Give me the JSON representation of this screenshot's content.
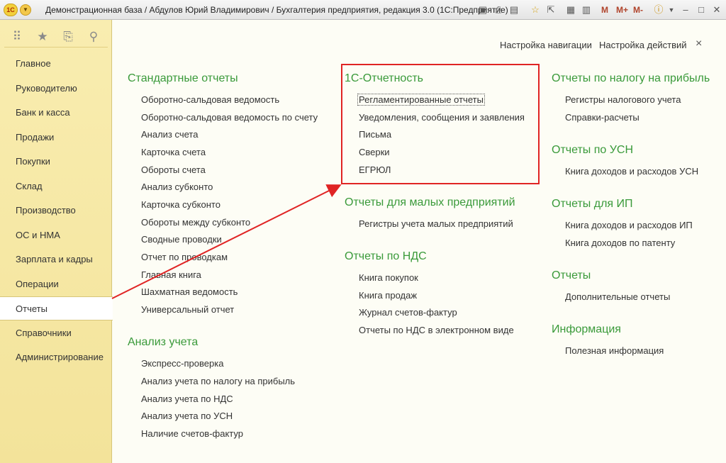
{
  "window": {
    "title": "Демонстрационная база / Абдулов Юрий Владимирович / Бухгалтерия предприятия, редакция 3.0  (1С:Предприятие)",
    "logo_text": "1С",
    "m_buttons": [
      "M",
      "M+",
      "M-"
    ]
  },
  "sidebar": {
    "items": [
      {
        "label": "Главное"
      },
      {
        "label": "Руководителю"
      },
      {
        "label": "Банк и касса"
      },
      {
        "label": "Продажи"
      },
      {
        "label": "Покупки"
      },
      {
        "label": "Склад"
      },
      {
        "label": "Производство"
      },
      {
        "label": "ОС и НМА"
      },
      {
        "label": "Зарплата и кадры"
      },
      {
        "label": "Операции"
      },
      {
        "label": "Отчеты"
      },
      {
        "label": "Справочники"
      },
      {
        "label": "Администрирование"
      }
    ],
    "active_index": 10
  },
  "header": {
    "nav_settings": "Настройка навигации",
    "action_settings": "Настройка действий",
    "close": "×"
  },
  "columns": {
    "col1": [
      {
        "title": "Стандартные отчеты",
        "items": [
          "Оборотно-сальдовая ведомость",
          "Оборотно-сальдовая ведомость по счету",
          "Анализ счета",
          "Карточка счета",
          "Обороты счета",
          "Анализ субконто",
          "Карточка субконто",
          "Обороты между субконто",
          "Сводные проводки",
          "Отчет по проводкам",
          "Главная книга",
          "Шахматная ведомость",
          "Универсальный отчет"
        ]
      },
      {
        "title": "Анализ учета",
        "items": [
          "Экспресс-проверка",
          "Анализ учета по налогу на прибыль",
          "Анализ учета по НДС",
          "Анализ учета по УСН",
          "Наличие счетов-фактур"
        ]
      }
    ],
    "col2": [
      {
        "title": "1С-Отчетность",
        "items": [
          "Регламентированные отчеты",
          "Уведомления, сообщения и заявления",
          "Письма",
          "Сверки",
          "ЕГРЮЛ"
        ]
      },
      {
        "title": "Отчеты для малых предприятий",
        "items": [
          "Регистры учета малых предприятий"
        ]
      },
      {
        "title": "Отчеты по НДС",
        "items": [
          "Книга покупок",
          "Книга продаж",
          "Журнал счетов-фактур",
          "Отчеты по НДС в электронном виде"
        ]
      }
    ],
    "col3": [
      {
        "title": "Отчеты по налогу на прибыль",
        "items": [
          "Регистры налогового учета",
          "Справки-расчеты"
        ]
      },
      {
        "title": "Отчеты по УСН",
        "items": [
          "Книга доходов и расходов УСН"
        ]
      },
      {
        "title": "Отчеты для ИП",
        "items": [
          "Книга доходов и расходов ИП",
          "Книга доходов по патенту"
        ]
      },
      {
        "title": "Отчеты",
        "items": [
          "Дополнительные отчеты"
        ]
      },
      {
        "title": "Информация",
        "items": [
          "Полезная информация"
        ]
      }
    ]
  },
  "colors": {
    "group_title": "#3a9a3a",
    "highlight": "#e02424",
    "sidebar_bg": "#f6e8a6"
  }
}
